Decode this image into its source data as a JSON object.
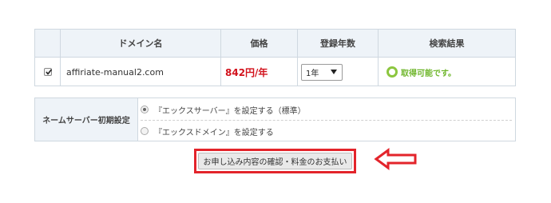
{
  "table": {
    "headers": [
      "ドメイン名",
      "価格",
      "登録年数",
      "検索結果"
    ],
    "row": {
      "checked": true,
      "domain": "affiriate-manual2.com",
      "price": "842円/年",
      "years": "1年",
      "result": "取得可能です。"
    }
  },
  "nameserver": {
    "label": "ネームサーバー初期設定",
    "options": [
      {
        "label": "『エックスサーバー』を設定する（標準）",
        "selected": true
      },
      {
        "label": "『エックスドメイン』を設定する",
        "selected": false
      }
    ]
  },
  "submit": {
    "label": "お申し込み内容の確認・料金のお支払い"
  },
  "colors": {
    "accent": "#e3242b",
    "available": "#6fb62c",
    "price": "#d2121c",
    "header_bg": "#eef3f8"
  }
}
